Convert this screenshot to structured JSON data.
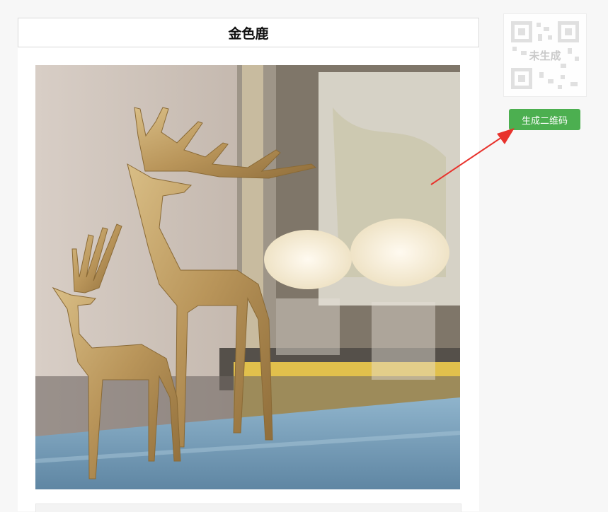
{
  "product": {
    "title": "金色鹿",
    "image_subject": "golden-deer-figurines"
  },
  "qr": {
    "status_label": "未生成",
    "generate_button_label": "生成二维码"
  },
  "colors": {
    "button_green": "#4caf50",
    "arrow_red": "#e8322c",
    "title_border": "#d9d9d9"
  }
}
